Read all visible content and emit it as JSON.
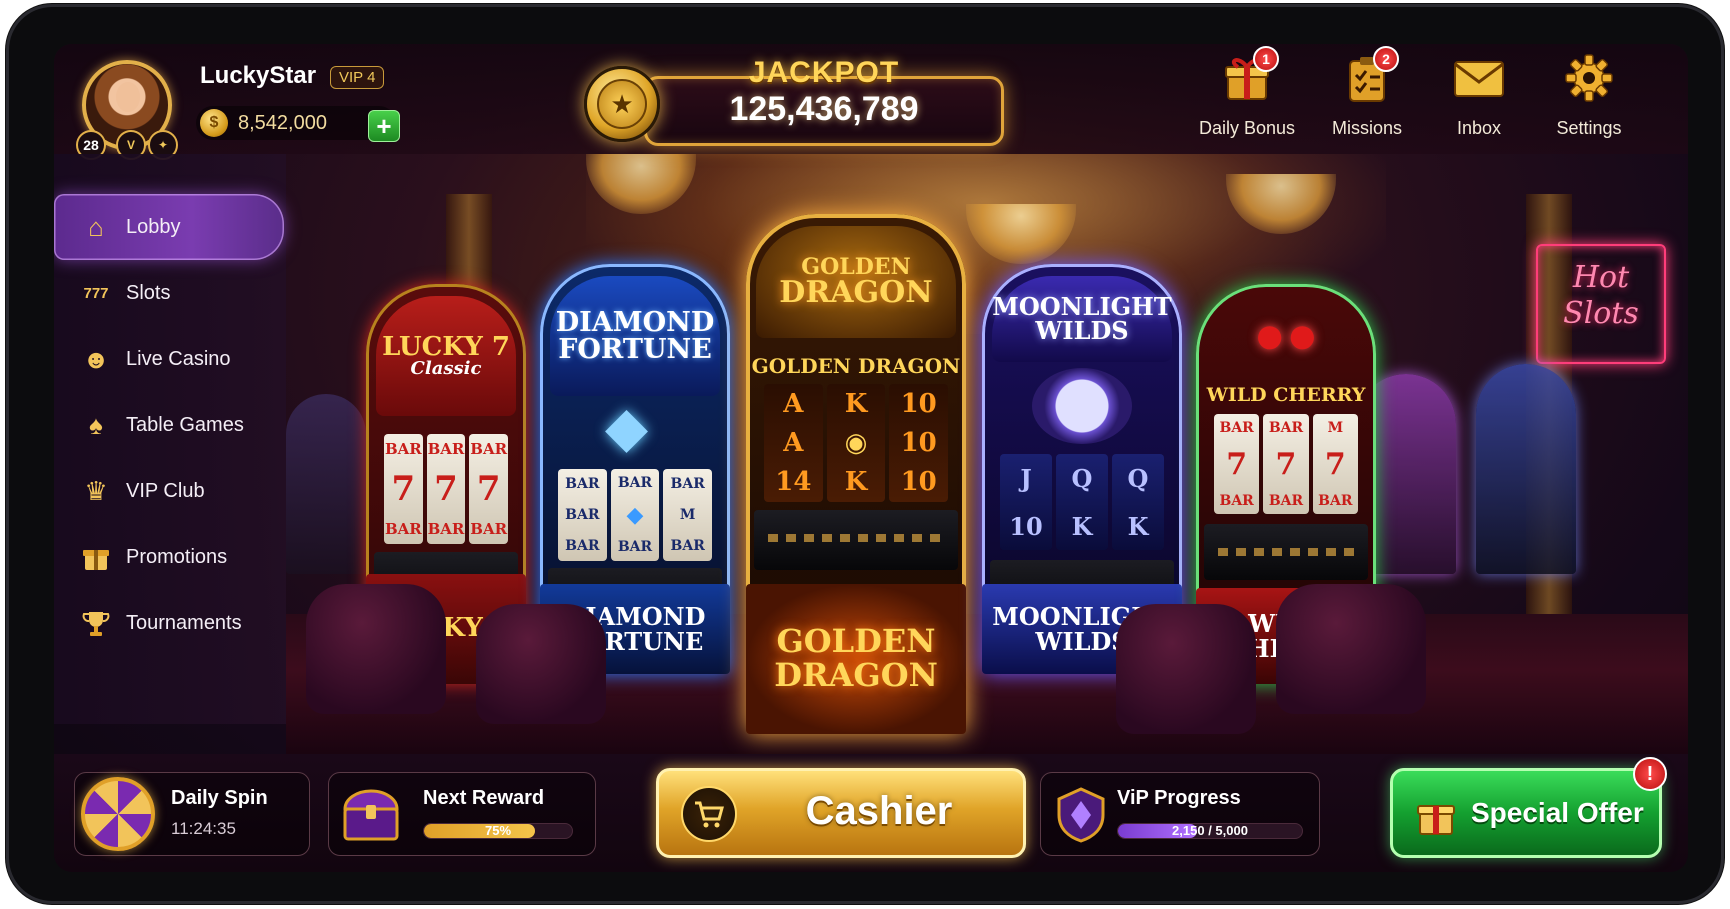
{
  "profile": {
    "username": "LuckyStar",
    "vip_tag": "VIP 4",
    "level": "28",
    "coins": "8,542,000",
    "coin_symbol": "$",
    "add_label": "+"
  },
  "jackpot": {
    "label": "JACKPOT",
    "value": "125,436,789"
  },
  "top_actions": [
    {
      "label": "Daily Bonus",
      "icon": "gift-icon",
      "badge": "1"
    },
    {
      "label": "Missions",
      "icon": "clipboard-icon",
      "badge": "2"
    },
    {
      "label": "Inbox",
      "icon": "envelope-icon",
      "badge": ""
    },
    {
      "label": "Settings",
      "icon": "gear-icon",
      "badge": ""
    }
  ],
  "sidebar": {
    "items": [
      {
        "label": "Lobby",
        "icon": "home-icon",
        "active": true
      },
      {
        "label": "Slots",
        "icon": "slot-reels-icon"
      },
      {
        "label": "Live Casino",
        "icon": "dealer-icon"
      },
      {
        "label": "Table Games",
        "icon": "cards-icon"
      },
      {
        "label": "VIP Club",
        "icon": "crown-icon"
      },
      {
        "label": "Promotions",
        "icon": "gift-icon"
      },
      {
        "label": "Tournaments",
        "icon": "trophy-icon"
      }
    ]
  },
  "machines": [
    {
      "title_1": "LUCKY 7",
      "title_2": "Classic",
      "subtitle": "",
      "base": "LUCKY 7",
      "reels": [
        [
          "BAR",
          "7",
          "BAR"
        ],
        [
          "BAR",
          "7",
          "BAR"
        ],
        [
          "BAR",
          "7",
          "BAR"
        ]
      ],
      "color": "#c8281e"
    },
    {
      "title_1": "DIAMOND",
      "title_2": "FORTUNE",
      "subtitle": "",
      "base": "DIAMOND FORTUNE",
      "reels": [
        [
          "BAR",
          "BAR",
          "BAR"
        ],
        [
          "BAR",
          "◆",
          "BAR"
        ],
        [
          "BAR",
          "M",
          "BAR"
        ]
      ],
      "color": "#2a6ae0"
    },
    {
      "title_1": "GOLDEN",
      "title_2": "DRAGON",
      "subtitle": "GOLDEN DRAGON",
      "base": "GOLDEN DRAGON",
      "reels": [
        [
          "A",
          "A",
          "14"
        ],
        [
          "K",
          "◉",
          "K"
        ],
        [
          "10",
          "10",
          "10"
        ]
      ],
      "color": "#e0a028"
    },
    {
      "title_1": "MOONLIGHT",
      "title_2": "WILDS",
      "subtitle": "",
      "base": "MOONLIGHT WILDS",
      "reels": [
        [
          "J",
          "10"
        ],
        [
          "Q",
          "K"
        ],
        [
          "Q",
          "K"
        ]
      ],
      "color": "#6a4ae0"
    },
    {
      "title_1": "",
      "title_2": "",
      "subtitle": "WILD CHERRY",
      "base": "WILD CHERRY",
      "reels": [
        [
          "BAR",
          "7",
          "BAR"
        ],
        [
          "BAR",
          "7",
          "BAR"
        ],
        [
          "M",
          "7",
          "BAR"
        ]
      ],
      "color": "#2ec44a"
    }
  ],
  "neon_sign": {
    "line_1": "Hot",
    "line_2": "Slots"
  },
  "bottom": {
    "daily_spin": {
      "title": "Daily Spin",
      "timer": "11:24:35"
    },
    "next_reward": {
      "title": "Next Reward",
      "progress_text": "75%",
      "progress": 0.75
    },
    "cashier": {
      "label": "Cashier"
    },
    "vip_progress": {
      "title": "ViP Progress",
      "progress_text": "2,150 / 5,000",
      "progress": 0.43
    },
    "special_offer": {
      "label": "Special Offer",
      "badge": "!"
    }
  },
  "colors": {
    "gold": "#e0a43a",
    "purple_active": "#7a3cb0",
    "green_offer": "#14a030",
    "badge_red": "#d81818"
  }
}
